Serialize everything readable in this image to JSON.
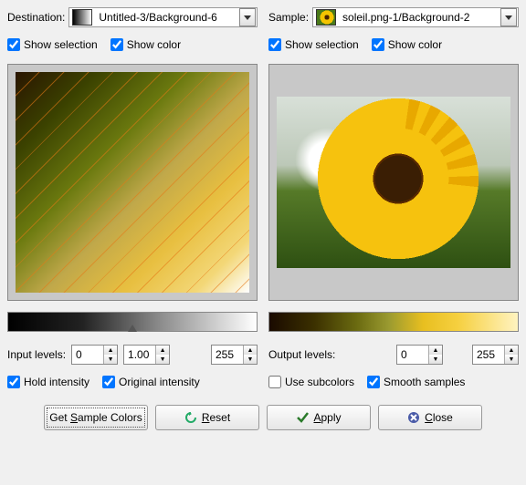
{
  "left": {
    "label": "Destination:",
    "dropdown": "Untitled-3/Background-6",
    "show_selection": "Show selection",
    "show_color": "Show color",
    "levels_label": "Input levels:",
    "level_low": "0",
    "level_mid": "1.00",
    "level_high": "255",
    "hold_intensity": "Hold intensity",
    "original_intensity": "Original intensity"
  },
  "right": {
    "label": "Sample:",
    "dropdown": "soleil.png-1/Background-2",
    "show_selection": "Show selection",
    "show_color": "Show color",
    "levels_label": "Output levels:",
    "level_low": "0",
    "level_high": "255",
    "use_subcolors": "Use subcolors",
    "smooth_samples": "Smooth samples"
  },
  "buttons": {
    "get_sample": "Get Sample Colors",
    "reset": "Reset",
    "apply": "Apply",
    "close": "Close"
  }
}
